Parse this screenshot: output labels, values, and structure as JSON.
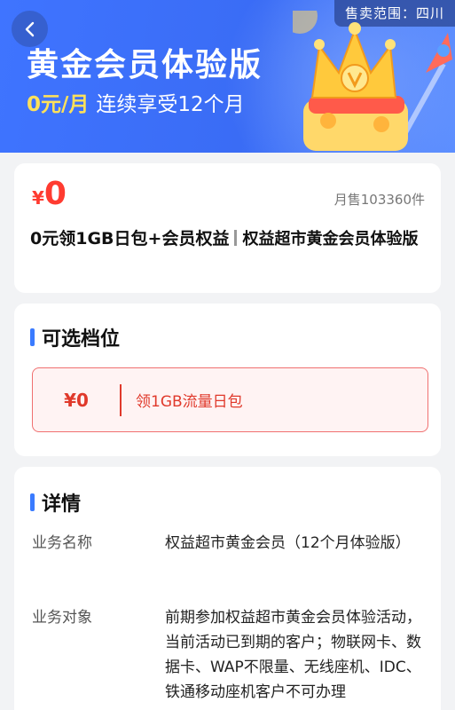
{
  "banner": {
    "region_tag": "售卖范围：四川",
    "title": "黄金会员体验版",
    "sub_price": "0元/月",
    "sub_text": "连续享受12个月"
  },
  "product": {
    "price_symbol": "¥",
    "price": "0",
    "sales": "月售103360件",
    "title_main": "0元领1GB日包+会员权益",
    "title_sub": "权益超市黄金会员体验版"
  },
  "options": {
    "heading": "可选档位",
    "items": [
      {
        "price": "¥0",
        "label": "领1GB流量日包"
      }
    ]
  },
  "detail": {
    "heading": "详情",
    "rows": [
      {
        "key": "业务名称",
        "value": "权益超市黄金会员（12个月体验版）"
      },
      {
        "key": "业务对象",
        "value": "前期参加权益超市黄金会员体验活动，当前活动已到期的客户；物联网卡、数据卡、WAP不限量、无线座机、IDC、铁通移动座机客户不可办理"
      }
    ]
  },
  "colors": {
    "banner_blue": "#3f74ff",
    "price_red": "#ff3b30",
    "accent_blue": "#3a7bff",
    "option_border": "#f07070"
  }
}
